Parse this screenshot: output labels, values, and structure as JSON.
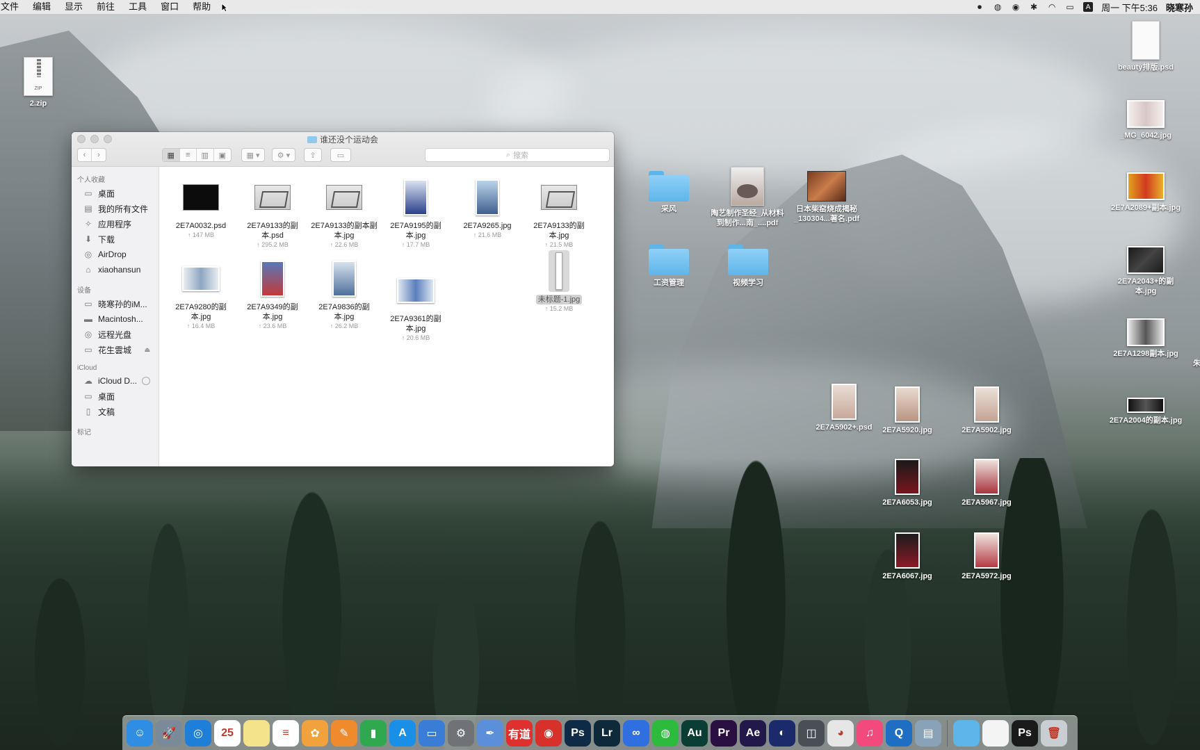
{
  "menubar": {
    "items": [
      "文件",
      "编辑",
      "显示",
      "前往",
      "工具",
      "窗口",
      "帮助"
    ],
    "clock": "周一 下午5:36",
    "user": "晓寒孙",
    "input_method": "A"
  },
  "desktop": {
    "left_icons": [
      {
        "label": "2.zip",
        "type": "zip",
        "badge": "ZIP"
      }
    ],
    "middle_icons": [
      {
        "label": "采风",
        "type": "folder"
      },
      {
        "label": "陶艺制作圣经_从材料到制作...南_....pdf",
        "type": "pdf-ceramic"
      },
      {
        "label": "日本柴窑烧成揭秘_130304...著名.pdf",
        "type": "pdf-kiln"
      },
      {
        "label": "工资管理",
        "type": "folder"
      },
      {
        "label": "视频学习",
        "type": "folder"
      }
    ],
    "portrait_icons": [
      {
        "label": "2E7A5902+.psd"
      },
      {
        "label": "2E7A5920.jpg"
      },
      {
        "label": "2E7A5902.jpg"
      },
      {
        "label": "2E7A6053.jpg"
      },
      {
        "label": "2E7A5967.jpg"
      },
      {
        "label": "2E7A6067.jpg"
      },
      {
        "label": "2E7A5972.jpg"
      }
    ],
    "right_icons": [
      {
        "label": "beauty排版.psd"
      },
      {
        "label": "_MG_6042.jpg"
      },
      {
        "label": "2E7A2089+副本.jpg"
      },
      {
        "label": "2E7A2043+的副本.jpg"
      },
      {
        "label": "2E7A1298副本.jpg"
      },
      {
        "label": "2E7A2004的副本.jpg"
      }
    ],
    "edge_text": "朱"
  },
  "finder": {
    "title": "谁还没个运动会",
    "search_placeholder": "搜索",
    "sidebar": {
      "favorites_header": "个人收藏",
      "favorites": [
        {
          "label": "桌面",
          "icon": "desktop-icon"
        },
        {
          "label": "我的所有文件",
          "icon": "all-files-icon"
        },
        {
          "label": "应用程序",
          "icon": "applications-icon"
        },
        {
          "label": "下载",
          "icon": "downloads-icon"
        },
        {
          "label": "AirDrop",
          "icon": "airdrop-icon"
        },
        {
          "label": "xiaohansun",
          "icon": "home-icon"
        }
      ],
      "devices_header": "设备",
      "devices": [
        {
          "label": "晓寒孙的iM...",
          "icon": "imac-icon"
        },
        {
          "label": "Macintosh...",
          "icon": "harddisk-icon"
        },
        {
          "label": "远程光盘",
          "icon": "disc-icon"
        },
        {
          "label": "花生雲城",
          "icon": "drive-icon"
        }
      ],
      "icloud_header": "iCloud",
      "icloud": [
        {
          "label": "iCloud D...",
          "icon": "cloud-icon"
        },
        {
          "label": "桌面",
          "icon": "desktop-icon"
        },
        {
          "label": "文稿",
          "icon": "documents-icon"
        }
      ],
      "tags_header": "标记"
    },
    "files": [
      {
        "name": "2E7A0032.psd",
        "size": "147 MB",
        "thumb": "dark"
      },
      {
        "name": "2E7A9133的副本.psd",
        "size": "295.2 MB",
        "thumb": "frame"
      },
      {
        "name": "2E7A9133的副本副本.jpg",
        "size": "22.6 MB",
        "thumb": "frame"
      },
      {
        "name": "2E7A9195的副本.jpg",
        "size": "17.7 MB",
        "thumb": "portrait"
      },
      {
        "name": "2E7A9265.jpg",
        "size": "21.6 MB",
        "thumb": "portrait"
      },
      {
        "name": "2E7A9133的副本.jpg",
        "size": "21.5 MB",
        "thumb": "frame"
      },
      {
        "name": "2E7A9280的副本.jpg",
        "size": "16.4 MB",
        "thumb": "landscape"
      },
      {
        "name": "2E7A9349的副本.jpg",
        "size": "23.6 MB",
        "thumb": "portrait"
      },
      {
        "name": "2E7A9836的副本.jpg",
        "size": "26.2 MB",
        "thumb": "portrait"
      },
      {
        "name": "2E7A9361的副本.jpg",
        "size": "20.6 MB",
        "thumb": "landscape"
      },
      {
        "name": "未标题-1.jpg",
        "size": "15.2 MB",
        "thumb": "narrow",
        "selected": true
      }
    ]
  },
  "dock": {
    "apps": [
      {
        "name": "finder-icon",
        "glyph": "☺",
        "color": "#2f8de4"
      },
      {
        "name": "launchpad-icon",
        "glyph": "🚀",
        "color": "#7b8a99"
      },
      {
        "name": "safari-icon",
        "glyph": "◎",
        "color": "#1e7fd9"
      },
      {
        "name": "calendar-icon",
        "glyph": "25",
        "color": "#ffffff"
      },
      {
        "name": "notes-icon",
        "glyph": "",
        "color": "#f4e38a"
      },
      {
        "name": "reminders-icon",
        "glyph": "≡",
        "color": "#ffffff"
      },
      {
        "name": "photos-icon",
        "glyph": "✿",
        "color": "#f1a23c"
      },
      {
        "name": "pages-icon",
        "glyph": "✎",
        "color": "#f08b2d"
      },
      {
        "name": "numbers-icon",
        "glyph": "▮",
        "color": "#2fa84f"
      },
      {
        "name": "app-store-icon",
        "glyph": "A",
        "color": "#1a8fe8"
      },
      {
        "name": "keynote-icon",
        "glyph": "▭",
        "color": "#3a7dd6"
      },
      {
        "name": "system-preferences-icon",
        "glyph": "⚙",
        "color": "#6f7377"
      },
      {
        "name": "preview-icon",
        "glyph": "✒",
        "color": "#5b8fd9"
      },
      {
        "name": "youdao-icon",
        "glyph": "有道",
        "color": "#e02f2f"
      },
      {
        "name": "netease-music-icon",
        "glyph": "◉",
        "color": "#d8302b"
      },
      {
        "name": "photoshop-icon",
        "glyph": "Ps",
        "color": "#0e2a47"
      },
      {
        "name": "lightroom-icon",
        "glyph": "Lr",
        "color": "#0e2a3a"
      },
      {
        "name": "baidu-netdisk-icon",
        "glyph": "∞",
        "color": "#2f6fe0"
      },
      {
        "name": "wechat-icon",
        "glyph": "◍",
        "color": "#2dbb3e"
      },
      {
        "name": "audition-icon",
        "glyph": "Au",
        "color": "#0a3d33"
      },
      {
        "name": "premiere-icon",
        "glyph": "Pr",
        "color": "#2a0f42"
      },
      {
        "name": "after-effects-icon",
        "glyph": "Ae",
        "color": "#22184a"
      },
      {
        "name": "cinema4d-icon",
        "glyph": "◐",
        "color": "#1b2a6b"
      },
      {
        "name": "screenshot-icon",
        "glyph": "◫",
        "color": "#4a4f55"
      },
      {
        "name": "chrome-icon",
        "glyph": "◕",
        "color": "#e6e6e6"
      },
      {
        "name": "itunes-icon",
        "glyph": "♫",
        "color": "#f34a7c"
      },
      {
        "name": "quicktime-icon",
        "glyph": "Q",
        "color": "#1e6fc4"
      },
      {
        "name": "image-capture-icon",
        "glyph": "▤",
        "color": "#8aa2b8"
      }
    ],
    "stacks": [
      {
        "name": "folder-stack-icon",
        "glyph": "",
        "color": "#5eb5ea"
      },
      {
        "name": "document-stack-icon",
        "glyph": "",
        "color": "#f4f4f4"
      },
      {
        "name": "screen-stack-icon",
        "glyph": "Ps",
        "color": "#1a1a1a"
      },
      {
        "name": "trash-icon",
        "glyph": "🗑",
        "color": "#c9ced2"
      }
    ]
  }
}
